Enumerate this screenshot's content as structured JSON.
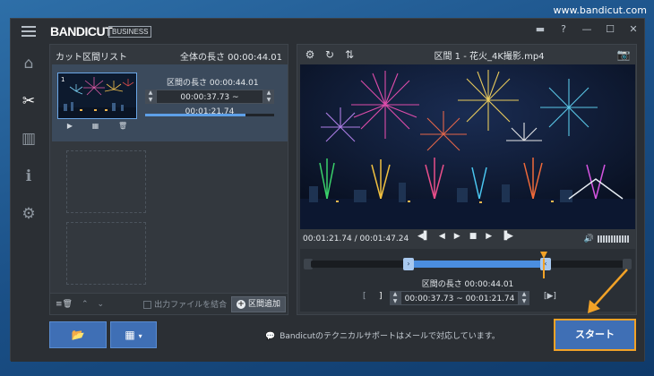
{
  "watermark": "www.bandicut.com",
  "app": {
    "logo_left": "BANDI",
    "logo_right": "CUT",
    "edition": "BUSINESS"
  },
  "titlebar_icons": [
    "folder-icon",
    "help-icon",
    "minimize-icon",
    "maximize-icon",
    "close-icon"
  ],
  "sidebar": {
    "items": [
      {
        "name": "home-icon",
        "glyph": "⌂"
      },
      {
        "name": "cut-icon",
        "glyph": "✂",
        "active": true
      },
      {
        "name": "split-icon",
        "glyph": "▥"
      },
      {
        "name": "info-icon",
        "glyph": "ℹ"
      },
      {
        "name": "settings-icon",
        "glyph": "⚙"
      }
    ],
    "record_glyph": "◉"
  },
  "cut_list": {
    "title": "カット区間リスト",
    "total_length": "全体の長さ 00:00:44.01",
    "clip": {
      "index": "1",
      "length": "区間の長さ 00:00:44.01",
      "start": "00:00:37.73",
      "sep": "~",
      "end": "00:01:21.74",
      "progress": 0.78
    },
    "merge_label": "出力ファイルを結合",
    "add_label": "区間追加"
  },
  "player": {
    "title": "区間 1 - 花火_4K撮影.mp4",
    "time": "00:01:21.74 / 00:01:47.24",
    "segment_length": "区間の長さ 00:00:44.01",
    "seg_start": "00:00:37.73",
    "seg_sep": "~",
    "seg_end": "00:01:21.74",
    "left_bracket": "[",
    "right_bracket": "]",
    "play_bracket": "[▶]"
  },
  "bottom": {
    "notice": "Bandicutのテクニカルサポートはメールで対応しています。",
    "start_label": "スタート"
  }
}
